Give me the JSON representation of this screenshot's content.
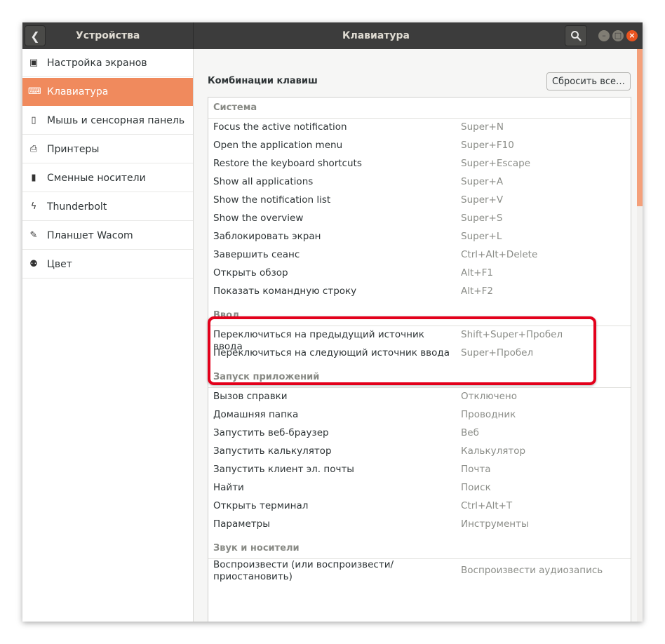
{
  "titlebar": {
    "left_title": "Устройства",
    "main_title": "Клавиатура"
  },
  "colors": {
    "accent": "#f08a5d",
    "titlebar_bg": "#3c3c3c",
    "close_button": "#e95420",
    "highlight": "#e3001b"
  },
  "sidebar": {
    "items": [
      {
        "label": "Настройка экранов",
        "icon": "display-icon",
        "active": false
      },
      {
        "label": "Клавиатура",
        "icon": "keyboard-icon",
        "active": true
      },
      {
        "label": "Мышь и сенсорная панель",
        "icon": "mouse-icon",
        "active": false
      },
      {
        "label": "Принтеры",
        "icon": "printer-icon",
        "active": false
      },
      {
        "label": "Сменные носители",
        "icon": "usb-drive-icon",
        "active": false
      },
      {
        "label": "Thunderbolt",
        "icon": "thunderbolt-icon",
        "active": false
      },
      {
        "label": "Планшет Wacom",
        "icon": "tablet-icon",
        "active": false
      },
      {
        "label": "Цвет",
        "icon": "color-icon",
        "active": false
      }
    ]
  },
  "main": {
    "section_title": "Комбинации клавиш",
    "reset_button": "Сбросить все…",
    "categories": [
      {
        "name": "Система",
        "rows": [
          {
            "name": "Focus the active notification",
            "key": "Super+N"
          },
          {
            "name": "Open the application menu",
            "key": "Super+F10"
          },
          {
            "name": "Restore the keyboard shortcuts",
            "key": "Super+Escape"
          },
          {
            "name": "Show all applications",
            "key": "Super+A"
          },
          {
            "name": "Show the notification list",
            "key": "Super+V"
          },
          {
            "name": "Show the overview",
            "key": "Super+S"
          },
          {
            "name": "Заблокировать экран",
            "key": "Super+L"
          },
          {
            "name": "Завершить сеанс",
            "key": "Ctrl+Alt+Delete"
          },
          {
            "name": "Открыть обзор",
            "key": "Alt+F1"
          },
          {
            "name": "Показать командную строку",
            "key": "Alt+F2"
          }
        ]
      },
      {
        "name": "Ввод",
        "rows": [
          {
            "name": "Переключиться на предыдущий источник ввода",
            "key": "Shift+Super+Пробел"
          },
          {
            "name": "Переключиться на следующий источник ввода",
            "key": "Super+Пробел"
          }
        ]
      },
      {
        "name": "Запуск приложений",
        "rows": [
          {
            "name": "Вызов справки",
            "key": "Отключено"
          },
          {
            "name": "Домашняя папка",
            "key": "Проводник"
          },
          {
            "name": "Запустить веб-браузер",
            "key": "Веб"
          },
          {
            "name": "Запустить калькулятор",
            "key": "Калькулятор"
          },
          {
            "name": "Запустить клиент эл. почты",
            "key": "Почта"
          },
          {
            "name": "Найти",
            "key": "Поиск"
          },
          {
            "name": "Открыть терминал",
            "key": "Ctrl+Alt+T"
          },
          {
            "name": "Параметры",
            "key": "Инструменты"
          }
        ]
      },
      {
        "name": "Звук и носители",
        "rows": [
          {
            "name": "Воспроизвести (или воспроизвести/ приостановить)",
            "key": "Воспроизвести аудиозапись"
          }
        ]
      }
    ]
  }
}
